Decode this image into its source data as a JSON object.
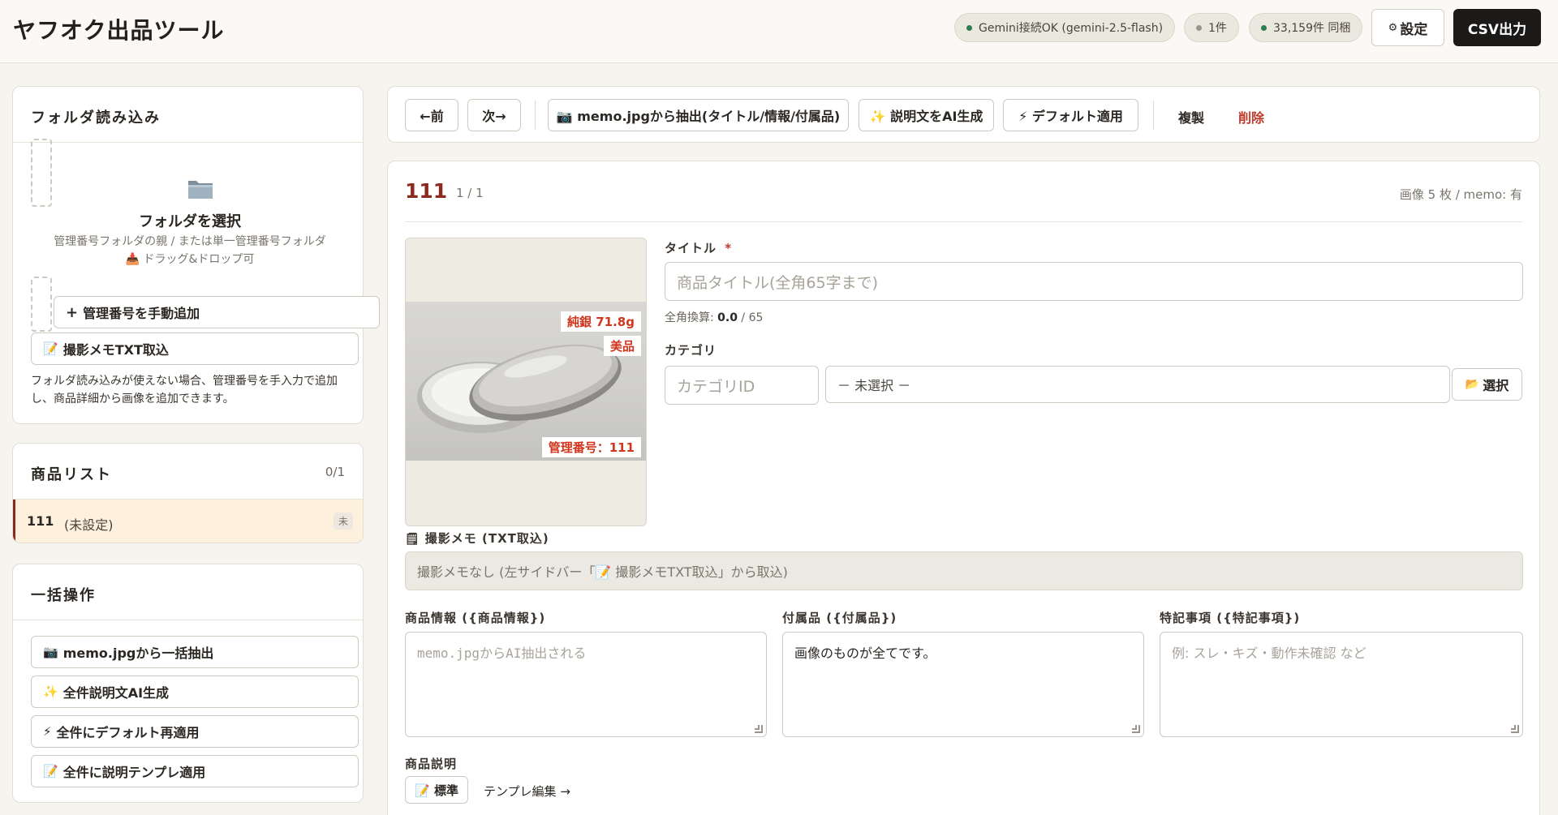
{
  "header": {
    "title": "ヤフオク出品ツール",
    "gemini_status": "Gemini接続OK (gemini-2.5-flash)",
    "item_count": "1件",
    "sync_status": "33,159件 同梱",
    "settings_icon": "gear-icon",
    "settings_label": "設定",
    "csv_label": "CSV出力",
    "status_color": "#2e7d4f"
  },
  "folder_panel": {
    "title": "フォルダ読み込み",
    "folder_icon": "folder-icon",
    "select_label": "フォルダを選択",
    "hint_line1": "管理番号フォルダの親 / または単一管理番号フォルダ",
    "hint_line2": "📥 ドラッグ&ドロップ可",
    "add_manual_label": "管理番号を手動追加",
    "import_memo_label": "撮影メモTXT取込",
    "note": "フォルダ読み込みが使えない場合、管理番号を手入力で追加し、商品詳細から画像を追加できます。"
  },
  "product_list": {
    "title": "商品リスト",
    "count": "0/1",
    "items": [
      {
        "id": "111",
        "status": "(未設定)",
        "badge": "未"
      }
    ]
  },
  "bulk_panel": {
    "title": "一括操作",
    "buttons": [
      {
        "icon": "📷",
        "label": "memo.jpgから一括抽出"
      },
      {
        "icon": "✨",
        "label": "全件説明文AI生成"
      },
      {
        "icon": "⚡",
        "label": "全件にデフォルト再適用"
      },
      {
        "icon": "📝",
        "label": "全件に説明テンプレ適用"
      }
    ]
  },
  "toolbar": {
    "prev_label": "←前",
    "next_label": "次→",
    "extract_label": "📷 memo.jpgから抽出(タイトル/情報/付属品)",
    "ai_desc_label": "✨ 説明文をAI生成",
    "default_label": "⚡ デフォルト適用",
    "duplicate_label": "複製",
    "delete_label": "削除"
  },
  "detail": {
    "id": "111",
    "position": "1 / 1",
    "meta": "画像 5 枚 / memo: 有",
    "image_tags": {
      "silver": "純銀 71.8g",
      "condition": "美品",
      "manage_no": "管理番号：111"
    },
    "title_label": "タイトル",
    "required_mark": "*",
    "title_placeholder": "商品タイトル(全角65字まで)",
    "char_count_prefix": "全角換算: ",
    "char_count_value": "0.0",
    "char_count_suffix": " / 65",
    "category_label": "カテゴリ",
    "category_id_placeholder": "カテゴリID",
    "category_value": "－ 未選択 －",
    "category_select_label": "選択",
    "memo_label": "撮影メモ (TXT取込)",
    "memo_text": "撮影メモなし (左サイドバー「📝 撮影メモTXT取込」から取込)",
    "info_label": "商品情報 ({商品情報})",
    "info_placeholder": "memo.jpgからAI抽出される",
    "accessory_label": "付属品 ({付属品})",
    "accessory_value": "画像のものが全てです。",
    "notes_label": "特記事項 ({特記事項})",
    "notes_placeholder": "例: スレ・キズ・動作未確認 など",
    "desc_label": "商品説明",
    "template_button": "📝 標準",
    "template_edit": "テンプレ編集 →"
  }
}
